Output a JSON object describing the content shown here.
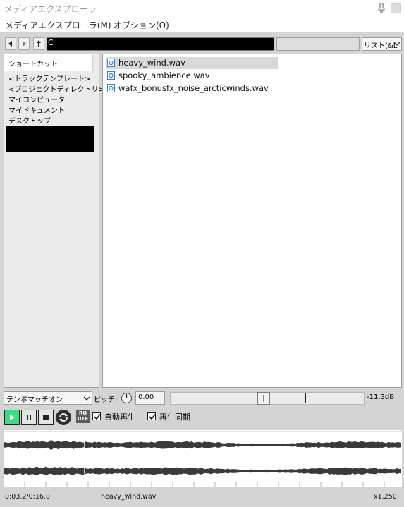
{
  "window": {
    "title": "メディアエクスプローラ"
  },
  "menu": {
    "items": [
      "メディアエクスプローラ(M)",
      "オプション(O)"
    ]
  },
  "toolbar": {
    "path_prefix": "C",
    "view_mode": "リスト(&L"
  },
  "shortcuts": {
    "tab_label": "ショートカット",
    "items": [
      "<トラックテンプレート>",
      "<プロジェクトディレクトリ>",
      "マイコンピュータ",
      "マイドキュメント",
      "デスクトップ"
    ]
  },
  "files": [
    {
      "name": "heavy_wind.wav",
      "selected": true
    },
    {
      "name": "spooky_ambience.wav",
      "selected": false
    },
    {
      "name": "wafx_bonusfx_noise_arcticwinds.wav",
      "selected": false
    }
  ],
  "controls": {
    "tempo_mode": "テンポマッチオン",
    "pitch_label": "ピッチ:",
    "pitch_value": "0.00",
    "volume_label": "-11.3dB",
    "volume_level": 0.48,
    "route_label_top": "RO",
    "route_label_bottom": "UTE",
    "auto_play_label": "自動再生",
    "auto_play_checked": true,
    "sync_play_label": "再生同期",
    "sync_play_checked": true
  },
  "status": {
    "position": "0:03.2/0:16.0",
    "filename": "heavy_wind.wav",
    "rate": "x1.250"
  },
  "colors": {
    "frame": "#d4d4d4",
    "play_active": "#3ddc84",
    "waveform": "#3a3a3a"
  }
}
